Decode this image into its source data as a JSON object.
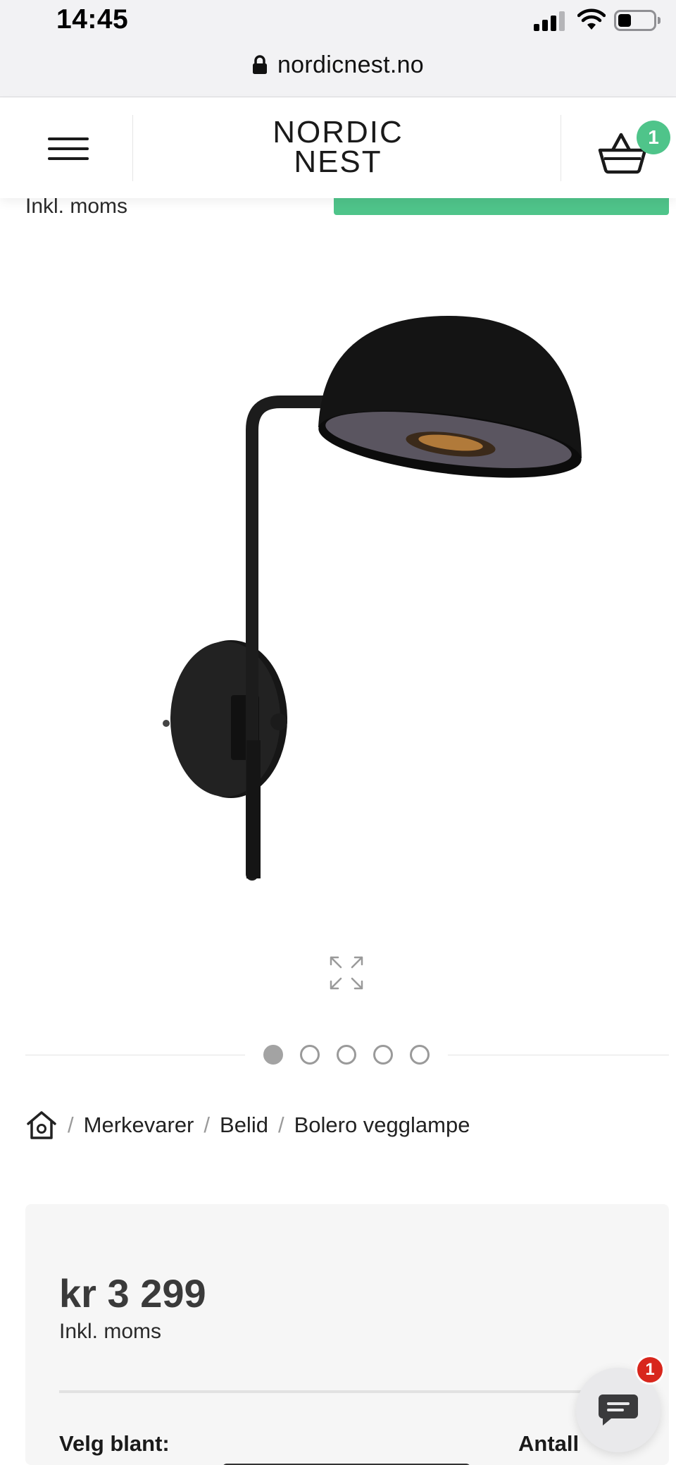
{
  "status_bar": {
    "time": "14:45"
  },
  "browser": {
    "url": "nordicnest.no"
  },
  "header": {
    "logo_line1": "NORDIC",
    "logo_line2": "NEST",
    "cart_count": "1"
  },
  "sticky": {
    "moms_text": "Inkl. moms",
    "accent_color": "#4fc48a"
  },
  "gallery": {
    "image_count": 5,
    "active_index": 0
  },
  "breadcrumb": {
    "items": [
      "Merkevarer",
      "Belid",
      "Bolero vegglampe"
    ],
    "separator": "/"
  },
  "price_box": {
    "price": "kr 3 299",
    "moms": "Inkl. moms",
    "choose_label": "Velg blant:",
    "quantity_label": "Antall"
  },
  "chat": {
    "unread": "1"
  },
  "icons": [
    "lock-icon",
    "menu-icon",
    "basket-icon",
    "expand-icon",
    "home-icon",
    "chat-icon"
  ]
}
